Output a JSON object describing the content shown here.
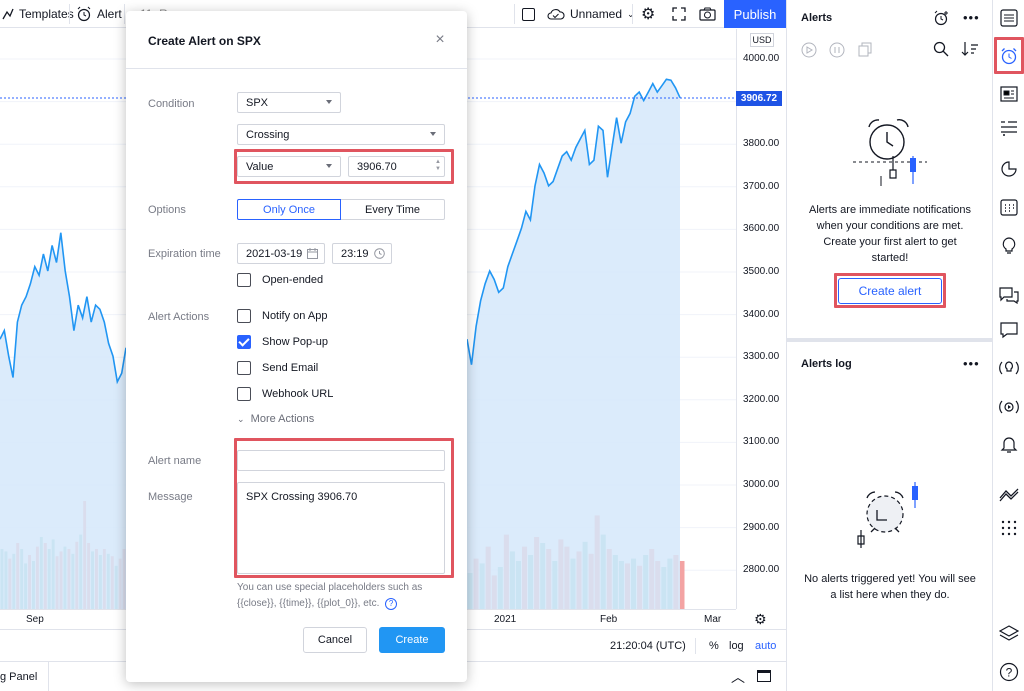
{
  "toolbar": {
    "templates_label": "Templates",
    "alert_label": "Alert",
    "partial_label": "11. Re",
    "layout_name": "Unnamed",
    "publish_label": "Publish"
  },
  "chart": {
    "currency": "USD",
    "current_price": "3906.72",
    "price_ticks": [
      "4000.00",
      "3900.00",
      "3800.00",
      "3700.00",
      "3600.00",
      "3500.00",
      "3400.00",
      "3300.00",
      "3200.00",
      "3100.00",
      "3000.00",
      "2900.00",
      "2800.00"
    ],
    "time_ticks": [
      "Sep",
      "2021",
      "Feb",
      "Mar"
    ],
    "timestamp": "21:20:04 (UTC)",
    "percent_label": "%",
    "log_label": "log",
    "auto_label": "auto",
    "bottom_panel_label": "g Panel",
    "colors": {
      "line": "#2196f3",
      "area": "#d5e8fa",
      "vol_up": "#8fd1c7",
      "vol_down": "#f3a3a3"
    },
    "price_line": [
      3340,
      3360,
      3300,
      3250,
      3380,
      3420,
      3440,
      3470,
      3510,
      3490,
      3540,
      3500,
      3560,
      3520,
      3590,
      3500,
      3440,
      3360,
      3420,
      3390,
      3440,
      3380,
      3420,
      3410,
      3380,
      3330,
      3300,
      3240,
      3260,
      3320,
      3340,
      3280,
      3370,
      3430,
      3470,
      3500,
      3480,
      3450,
      3460,
      3510,
      3540,
      3570,
      3600,
      3640,
      3620,
      3700,
      3750,
      3730,
      3700,
      3710,
      3740,
      3770,
      3780,
      3760,
      3790,
      3810,
      3830,
      3750,
      3760,
      3840,
      3830,
      3720,
      3790,
      3860,
      3800,
      3850,
      3870,
      3910,
      3920,
      3900,
      3920,
      3940,
      3920,
      3935,
      3950,
      3948,
      3930,
      3906.7
    ],
    "volumes": [
      0.5,
      0.48,
      0.42,
      0.46,
      0.55,
      0.5,
      0.38,
      0.45,
      0.4,
      0.52,
      0.6,
      0.55,
      0.5,
      0.58,
      0.44,
      0.48,
      0.52,
      0.5,
      0.46,
      0.56,
      0.62,
      0.9,
      0.55,
      0.48,
      0.5,
      0.45,
      0.5,
      0.46,
      0.44,
      0.36,
      0.42,
      0.5
    ],
    "volumes_right": [
      0.3,
      0.42,
      0.38,
      0.52,
      0.28,
      0.35,
      0.62,
      0.48,
      0.4,
      0.52,
      0.45,
      0.6,
      0.55,
      0.5,
      0.4,
      0.58,
      0.52,
      0.42,
      0.48,
      0.56,
      0.46,
      0.78,
      0.62,
      0.5,
      0.45,
      0.4,
      0.38,
      0.42,
      0.36,
      0.45,
      0.5,
      0.4,
      0.35,
      0.42,
      0.45,
      0.4
    ],
    "vol_dir": [
      1,
      1,
      0,
      1,
      0,
      1,
      1,
      0,
      1,
      0,
      1,
      0,
      1,
      1,
      0,
      0,
      1,
      0,
      1,
      0,
      1,
      0,
      0,
      1,
      0,
      1,
      0,
      1,
      0,
      1,
      0,
      0
    ],
    "vol_dir_right": [
      1,
      0,
      1,
      0,
      0,
      1,
      0,
      1,
      1,
      0,
      1,
      0,
      1,
      0,
      1,
      0,
      0,
      1,
      0,
      1,
      0,
      0,
      1,
      0,
      1,
      1,
      0,
      1,
      0,
      1,
      0,
      0,
      1,
      1,
      0,
      0
    ]
  },
  "dialog": {
    "title": "Create Alert on SPX",
    "close": "×",
    "condition_label": "Condition",
    "symbol": "SPX",
    "condition_type": "Crossing",
    "value_type": "Value",
    "value": "3906.70",
    "options_label": "Options",
    "option_once": "Only Once",
    "option_every": "Every Time",
    "expiration_label": "Expiration time",
    "exp_date": "2021-03-19",
    "exp_time": "23:19",
    "open_ended": "Open-ended",
    "actions_label": "Alert Actions",
    "notify_app": "Notify on App",
    "show_popup": "Show Pop-up",
    "send_email": "Send Email",
    "webhook": "Webhook URL",
    "more_actions": "More Actions",
    "alert_name_label": "Alert name",
    "alert_name_value": "",
    "message_label": "Message",
    "message_value": "SPX Crossing 3906.70",
    "hint_line1": "You can use special placeholders such as",
    "hint_line2": "{{close}}, {{time}}, {{plot_0}}, etc.",
    "cancel_label": "Cancel",
    "create_label": "Create"
  },
  "alerts_panel": {
    "title": "Alerts",
    "empty_line1": "Alerts are immediate notifications",
    "empty_line2": "when your conditions are met.",
    "empty_line3": "Create your first alert to get",
    "empty_line4": "started!",
    "create_alert": "Create alert",
    "more": "•••"
  },
  "alerts_log": {
    "title": "Alerts log",
    "empty_line1": "No alerts triggered yet! You will see",
    "empty_line2": "a list here when they do.",
    "more": "•••"
  }
}
